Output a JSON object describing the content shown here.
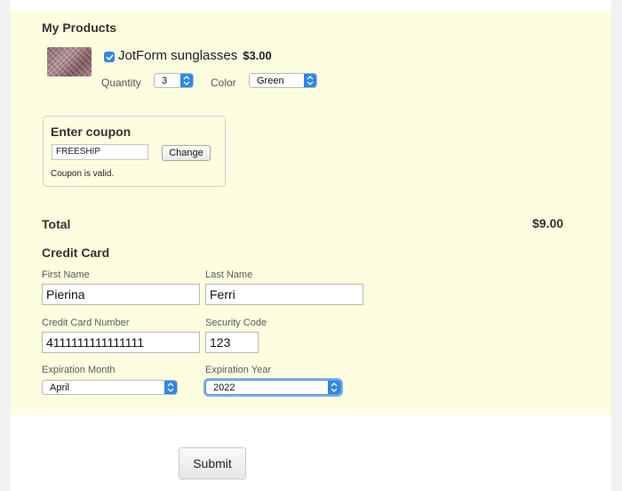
{
  "products": {
    "title": "My Products",
    "item": {
      "name": "JotForm sunglasses",
      "price": "$3.00",
      "checked": true,
      "quantity_label": "Quantity",
      "quantity_value": "3",
      "color_label": "Color",
      "color_value": "Green"
    }
  },
  "coupon": {
    "title": "Enter coupon",
    "code": "FREESHIP",
    "change_label": "Change",
    "status": "Coupon is valid."
  },
  "total": {
    "label": "Total",
    "amount": "$9.00"
  },
  "credit_card": {
    "title": "Credit Card",
    "first_name_label": "First Name",
    "first_name_value": "Pierina",
    "last_name_label": "Last Name",
    "last_name_value": "Ferri",
    "number_label": "Credit Card Number",
    "number_value": "4111111111111111",
    "security_label": "Security Code",
    "security_value": "123",
    "exp_month_label": "Expiration Month",
    "exp_month_value": "April",
    "exp_year_label": "Expiration Year",
    "exp_year_value": "2022"
  },
  "submit_label": "Submit",
  "colors": {
    "panel_bg": "#fdfde0",
    "accent": "#2f87e6"
  }
}
